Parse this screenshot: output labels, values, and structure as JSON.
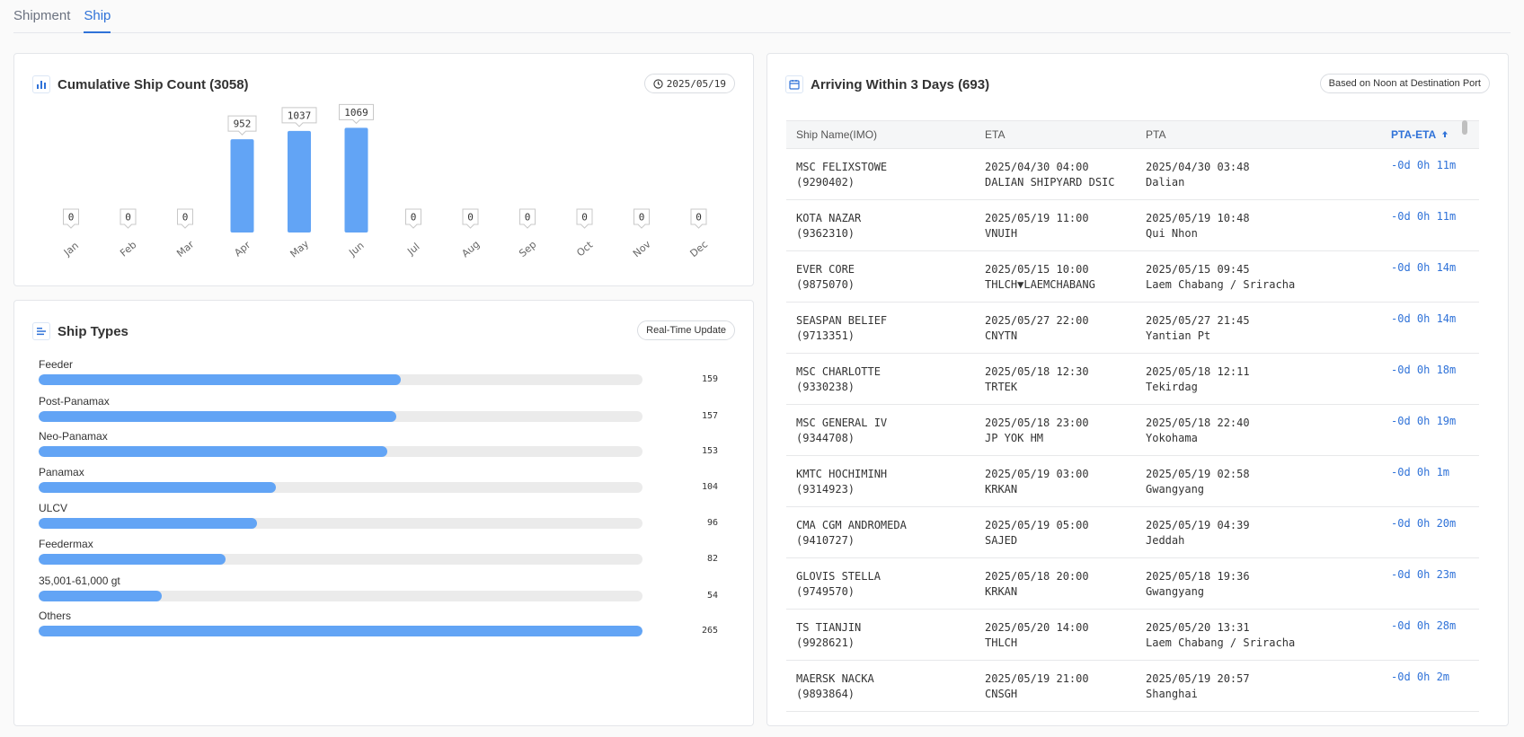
{
  "tabs": [
    {
      "label": "Shipment",
      "active": false
    },
    {
      "label": "Ship",
      "active": true
    }
  ],
  "cumulative": {
    "title": "Cumulative Ship Count (3058)",
    "date": "2025/05/19",
    "icon": "bar-chart-icon",
    "date_icon": "clock-icon"
  },
  "chart_data": {
    "type": "bar",
    "categories": [
      "Jan",
      "Feb",
      "Mar",
      "Apr",
      "May",
      "Jun",
      "Jul",
      "Aug",
      "Sep",
      "Oct",
      "Nov",
      "Dec"
    ],
    "values": [
      0,
      0,
      0,
      952,
      1037,
      1069,
      0,
      0,
      0,
      0,
      0,
      0
    ],
    "bar_color": "#62a4f5",
    "grid": false,
    "ylim": [
      0,
      1100
    ]
  },
  "ship_types": {
    "title": "Ship Types",
    "badge": "Real-Time Update",
    "icon": "list-icon",
    "max": 265,
    "items": [
      {
        "name": "Feeder",
        "count": 159
      },
      {
        "name": "Post-Panamax",
        "count": 157
      },
      {
        "name": "Neo-Panamax",
        "count": 153
      },
      {
        "name": "Panamax",
        "count": 104
      },
      {
        "name": "ULCV",
        "count": 96
      },
      {
        "name": "Feedermax",
        "count": 82
      },
      {
        "name": "35,001-61,000 gt",
        "count": 54
      },
      {
        "name": "Others",
        "count": 265
      }
    ]
  },
  "arriving": {
    "title": "Arriving Within 3 Days (693)",
    "badge": "Based on Noon at Destination Port",
    "icon": "calendar-icon",
    "columns": {
      "name": "Ship Name(IMO)",
      "eta": "ETA",
      "pta": "PTA",
      "diff": "PTA-ETA"
    },
    "sort_icon": "arrow-up-icon",
    "rows": [
      {
        "name": "MSC FELIXSTOWE",
        "imo": "(9290402)",
        "eta": "2025/04/30 04:00",
        "eta_port": "DALIAN SHIPYARD DSIC",
        "pta": "2025/04/30 03:48",
        "pta_port": "Dalian",
        "diff": "-0d 0h 11m"
      },
      {
        "name": "KOTA NAZAR",
        "imo": "(9362310)",
        "eta": "2025/05/19 11:00",
        "eta_port": "VNUIH",
        "pta": "2025/05/19 10:48",
        "pta_port": "Qui Nhon",
        "diff": "-0d 0h 11m"
      },
      {
        "name": "EVER CORE",
        "imo": "(9875070)",
        "eta": "2025/05/15 10:00",
        "eta_port": "THLCH▼LAEMCHABANG",
        "pta": "2025/05/15 09:45",
        "pta_port": "Laem Chabang / Sriracha",
        "diff": "-0d 0h 14m"
      },
      {
        "name": "SEASPAN BELIEF",
        "imo": "(9713351)",
        "eta": "2025/05/27 22:00",
        "eta_port": "CNYTN",
        "pta": "2025/05/27 21:45",
        "pta_port": "Yantian Pt",
        "diff": "-0d 0h 14m"
      },
      {
        "name": "MSC CHARLOTTE",
        "imo": "(9330238)",
        "eta": "2025/05/18 12:30",
        "eta_port": "TRTEK",
        "pta": "2025/05/18 12:11",
        "pta_port": "Tekirdag",
        "diff": "-0d 0h 18m"
      },
      {
        "name": "MSC GENERAL IV",
        "imo": "(9344708)",
        "eta": "2025/05/18 23:00",
        "eta_port": "JP YOK HM",
        "pta": "2025/05/18 22:40",
        "pta_port": "Yokohama",
        "diff": "-0d 0h 19m"
      },
      {
        "name": "KMTC HOCHIMINH",
        "imo": "(9314923)",
        "eta": "2025/05/19 03:00",
        "eta_port": "KRKAN",
        "pta": "2025/05/19 02:58",
        "pta_port": "Gwangyang",
        "diff": "-0d 0h 1m"
      },
      {
        "name": "CMA CGM ANDROMEDA",
        "imo": "(9410727)",
        "eta": "2025/05/19 05:00",
        "eta_port": "SAJED",
        "pta": "2025/05/19 04:39",
        "pta_port": "Jeddah",
        "diff": "-0d 0h 20m"
      },
      {
        "name": "GLOVIS STELLA",
        "imo": "(9749570)",
        "eta": "2025/05/18 20:00",
        "eta_port": "KRKAN",
        "pta": "2025/05/18 19:36",
        "pta_port": "Gwangyang",
        "diff": "-0d 0h 23m"
      },
      {
        "name": "TS TIANJIN",
        "imo": "(9928621)",
        "eta": "2025/05/20 14:00",
        "eta_port": "THLCH",
        "pta": "2025/05/20 13:31",
        "pta_port": "Laem Chabang / Sriracha",
        "diff": "-0d 0h 28m"
      },
      {
        "name": "MAERSK NACKA",
        "imo": "(9893864)",
        "eta": "2025/05/19 21:00",
        "eta_port": "CNSGH",
        "pta": "2025/05/19 20:57",
        "pta_port": "Shanghai",
        "diff": "-0d 0h 2m"
      }
    ]
  }
}
